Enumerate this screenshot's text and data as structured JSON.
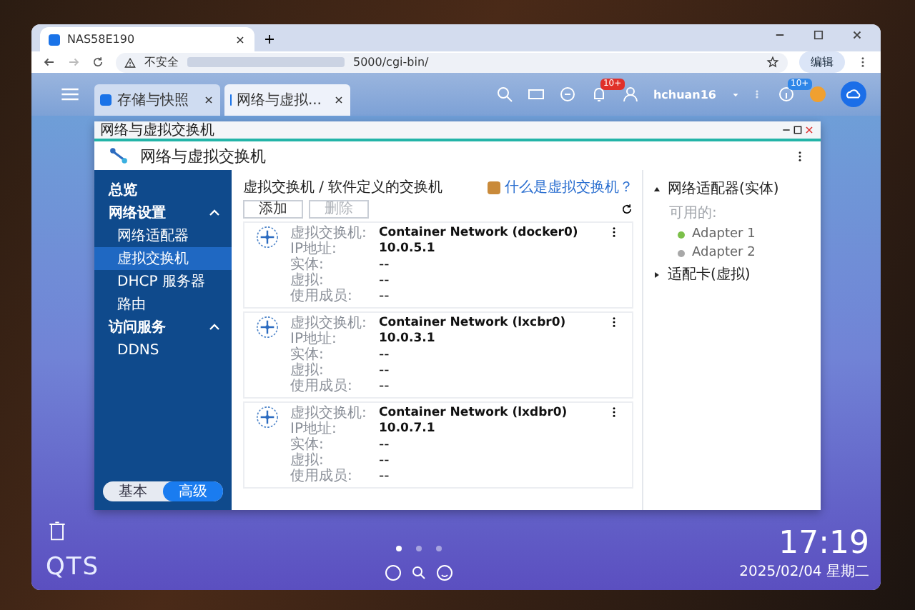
{
  "browser": {
    "tabs": [
      {
        "label": "NAS58E190",
        "selected": true
      }
    ],
    "address": {
      "security": "不安全",
      "url": "5000/cgi-bin/"
    },
    "profile_button": "编辑"
  },
  "qts_bar": {
    "tabs": [
      {
        "label": "存储与快照",
        "selected": false
      },
      {
        "label": "网络与虚拟...",
        "selected": true
      }
    ],
    "notification_badge": "10+",
    "user": "hchuan16",
    "info_badge": "10+"
  },
  "window": {
    "caption": "网络与虚拟交换机",
    "title": "网络与虚拟交换机",
    "sidebar": {
      "items": [
        {
          "label": "总览",
          "kind": "top",
          "selected": false
        },
        {
          "label": "网络设置",
          "kind": "group",
          "expanded": true,
          "children": [
            {
              "label": "网络适配器",
              "selected": false
            },
            {
              "label": "虚拟交换机",
              "selected": true
            },
            {
              "label": "DHCP 服务器",
              "selected": false
            },
            {
              "label": "路由",
              "selected": false
            }
          ]
        },
        {
          "label": "访问服务",
          "kind": "group",
          "expanded": true,
          "children": [
            {
              "label": "DDNS",
              "selected": false
            }
          ]
        }
      ],
      "mode_toggle": [
        {
          "label": "基本",
          "selected": false
        },
        {
          "label": "高级",
          "selected": true
        }
      ]
    },
    "content": {
      "heading": "虚拟交换机 / 软件定义的交换机",
      "help_link": "什么是虚拟交换机？",
      "buttons": [
        {
          "label": "添加",
          "disabled": false
        },
        {
          "label": "删除",
          "disabled": true
        }
      ],
      "switches": [
        {
          "fields": [
            {
              "label": "虚拟交换机:",
              "value": "Container Network (docker0)"
            },
            {
              "label": "IP地址:",
              "value": "10.0.5.1"
            },
            {
              "label": "实体:",
              "value": "--"
            },
            {
              "label": "虚拟:",
              "value": "--"
            },
            {
              "label": "使用成员:",
              "value": "--"
            }
          ]
        },
        {
          "fields": [
            {
              "label": "虚拟交换机:",
              "value": "Container Network (lxcbr0)"
            },
            {
              "label": "IP地址:",
              "value": "10.0.3.1"
            },
            {
              "label": "实体:",
              "value": "--"
            },
            {
              "label": "虚拟:",
              "value": "--"
            },
            {
              "label": "使用成员:",
              "value": "--"
            }
          ]
        },
        {
          "fields": [
            {
              "label": "虚拟交换机:",
              "value": "Container Network (lxdbr0)"
            },
            {
              "label": "IP地址:",
              "value": "10.0.7.1"
            },
            {
              "label": "实体:",
              "value": "--"
            },
            {
              "label": "虚拟:",
              "value": "--"
            },
            {
              "label": "使用成员:",
              "value": "--"
            }
          ]
        }
      ]
    },
    "side_panel": {
      "groups": [
        {
          "label": "网络适配器(实体)",
          "expanded": true,
          "caption": "可用的:",
          "adapters": [
            {
              "name": "Adapter 1",
              "color": "#7cc04a"
            },
            {
              "name": "Adapter 2",
              "color": "#a8a8a8"
            }
          ]
        },
        {
          "label": "适配卡(虚拟)",
          "expanded": false
        }
      ]
    }
  },
  "desktop": {
    "logo": "QTS",
    "pages": [
      {
        "selected": true
      },
      {
        "selected": false
      },
      {
        "selected": false
      }
    ],
    "time": "17:19",
    "date": "2025/02/04 星期二"
  }
}
